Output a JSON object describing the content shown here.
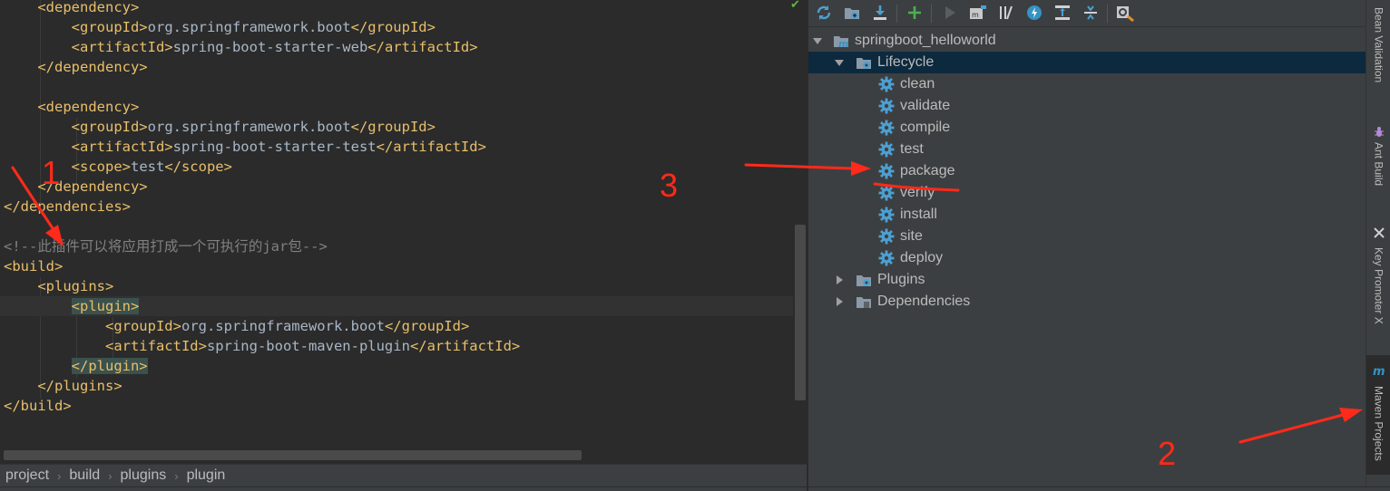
{
  "editor": {
    "lines": [
      {
        "ind": "    ",
        "parts": [
          [
            "tag",
            "<dependency>"
          ]
        ]
      },
      {
        "ind": "        ",
        "parts": [
          [
            "tag",
            "<groupId>"
          ],
          [
            "txt",
            "org.springframework.boot"
          ],
          [
            "tag",
            "</groupId>"
          ]
        ]
      },
      {
        "ind": "        ",
        "parts": [
          [
            "tag",
            "<artifactId>"
          ],
          [
            "txt",
            "spring-boot-starter-web"
          ],
          [
            "tag",
            "</artifactId>"
          ]
        ]
      },
      {
        "ind": "    ",
        "parts": [
          [
            "tag",
            "</dependency>"
          ]
        ]
      },
      {
        "ind": "",
        "parts": []
      },
      {
        "ind": "    ",
        "parts": [
          [
            "tag",
            "<dependency>"
          ]
        ]
      },
      {
        "ind": "        ",
        "parts": [
          [
            "tag",
            "<groupId>"
          ],
          [
            "txt",
            "org.springframework.boot"
          ],
          [
            "tag",
            "</groupId>"
          ]
        ]
      },
      {
        "ind": "        ",
        "parts": [
          [
            "tag",
            "<artifactId>"
          ],
          [
            "txt",
            "spring-boot-starter-test"
          ],
          [
            "tag",
            "</artifactId>"
          ]
        ]
      },
      {
        "ind": "        ",
        "parts": [
          [
            "tag",
            "<scope>"
          ],
          [
            "txt",
            "test"
          ],
          [
            "tag",
            "</scope>"
          ]
        ]
      },
      {
        "ind": "    ",
        "parts": [
          [
            "tag",
            "</dependency>"
          ]
        ]
      },
      {
        "ind": "",
        "parts": [
          [
            "tag",
            "</dependencies>"
          ]
        ]
      },
      {
        "ind": "",
        "parts": []
      },
      {
        "ind": "",
        "parts": [
          [
            "cmt",
            "<!--此插件可以将应用打成一个可执行的jar包-->"
          ]
        ]
      },
      {
        "ind": "",
        "parts": [
          [
            "tag",
            "<build>"
          ]
        ]
      },
      {
        "ind": "    ",
        "parts": [
          [
            "tag",
            "<plugins>"
          ]
        ]
      },
      {
        "ind": "        ",
        "parts": [
          [
            "hltag",
            "<plugin>"
          ]
        ],
        "current": true
      },
      {
        "ind": "            ",
        "parts": [
          [
            "tag",
            "<groupId>"
          ],
          [
            "txt",
            "org.springframework.boot"
          ],
          [
            "tag",
            "</groupId>"
          ]
        ]
      },
      {
        "ind": "            ",
        "parts": [
          [
            "tag",
            "<artifactId>"
          ],
          [
            "txt",
            "spring-boot-maven-plugin"
          ],
          [
            "tag",
            "</artifactId>"
          ]
        ]
      },
      {
        "ind": "        ",
        "parts": [
          [
            "hltag",
            "</plugin>"
          ]
        ]
      },
      {
        "ind": "    ",
        "parts": [
          [
            "tag",
            "</plugins>"
          ]
        ]
      },
      {
        "ind": "",
        "parts": [
          [
            "tag",
            "</build>"
          ]
        ]
      }
    ]
  },
  "breadcrumb": {
    "items": [
      "project",
      "build",
      "plugins",
      "plugin"
    ],
    "separator": "›"
  },
  "maven": {
    "toolbar": {
      "buttons": [
        "reimport-icon",
        "generate-sources-icon",
        "download-icon",
        "add-icon",
        "run-icon",
        "execute-goal-icon",
        "toggle-offline-icon",
        "skip-tests-icon",
        "show-dependencies-icon",
        "collapse-all-icon",
        "settings-icon"
      ]
    },
    "project": "springboot_helloworld",
    "lifecycle_label": "Lifecycle",
    "goals": [
      "clean",
      "validate",
      "compile",
      "test",
      "package",
      "verify",
      "install",
      "site",
      "deploy"
    ],
    "plugins_label": "Plugins",
    "dependencies_label": "Dependencies"
  },
  "right_strip": {
    "tabs": [
      "Bean Validation",
      "Ant Build",
      "Key Promoter X",
      "Maven Projects"
    ]
  },
  "annotations": {
    "n1": "1",
    "n2": "2",
    "n3": "3"
  },
  "colors": {
    "editor_bg": "#2b2b2b",
    "panel_bg": "#3c3f41",
    "tag": "#e8bf6a",
    "text": "#a9b7c6",
    "comment": "#808080",
    "selection": "#0d293e",
    "gear": "#4e9fd1",
    "annotation": "#ff2a1a"
  }
}
